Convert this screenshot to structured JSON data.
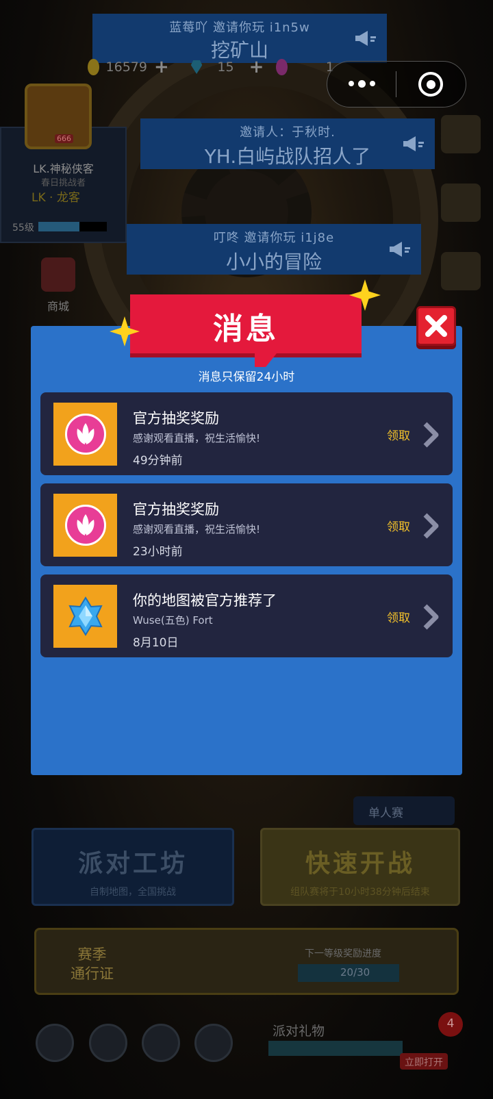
{
  "background": {
    "banners": [
      {
        "sub": "蓝莓吖    邀请你玩 i1n5w",
        "main": "挖矿山"
      },
      {
        "sub": "邀请人：于秋时.",
        "main": "YH.白屿战队招人了"
      },
      {
        "sub": "叮咚 邀请你玩 i1j8e",
        "main": "小小的冒险"
      }
    ],
    "currency": {
      "coins": "16579",
      "gems": "15",
      "tickets": "1"
    },
    "profile": {
      "name": "LK.神秘侠客",
      "title": "春日挑战者",
      "clan": "LK · 龙客",
      "level": "55级",
      "level_progress": 0.6,
      "avatar_badge": "666"
    },
    "shop_label": "商城",
    "mode_label": "单人赛",
    "workshop": {
      "title": "派对工坊",
      "subtitle": "自制地图，全国挑战"
    },
    "quick_battle": {
      "title": "快速开战",
      "subtitle": "组队赛将于10小时38分钟后结束"
    },
    "season_pass": {
      "line1": "赛季",
      "line2": "通行证",
      "progress_label": "下一等级奖励进度",
      "progress": "20/30"
    },
    "gift": {
      "label": "派对礼物",
      "open_label": "立即打开",
      "badge": "4"
    }
  },
  "modal": {
    "title": "消息",
    "subtitle": "消息只保留24小时",
    "messages": [
      {
        "title": "官方抽奖奖励",
        "desc": "感谢观看直播，祝生活愉快!",
        "time": "49分钟前",
        "action": "领取",
        "icon": "lotus-icon"
      },
      {
        "title": "官方抽奖奖励",
        "desc": "感谢观看直播，祝生活愉快!",
        "time": "23小时前",
        "action": "领取",
        "icon": "lotus-icon"
      },
      {
        "title": "你的地图被官方推荐了",
        "desc": "Wuse(五色) Fort",
        "time": "8月10日",
        "action": "领取",
        "icon": "crystal-icon"
      }
    ]
  },
  "colors": {
    "modal_bg": "#2b72c9",
    "ribbon": "#e4193c",
    "card_bg": "#22253f",
    "claim": "#f4c22a",
    "thumb_bg": "#f2a21c"
  }
}
